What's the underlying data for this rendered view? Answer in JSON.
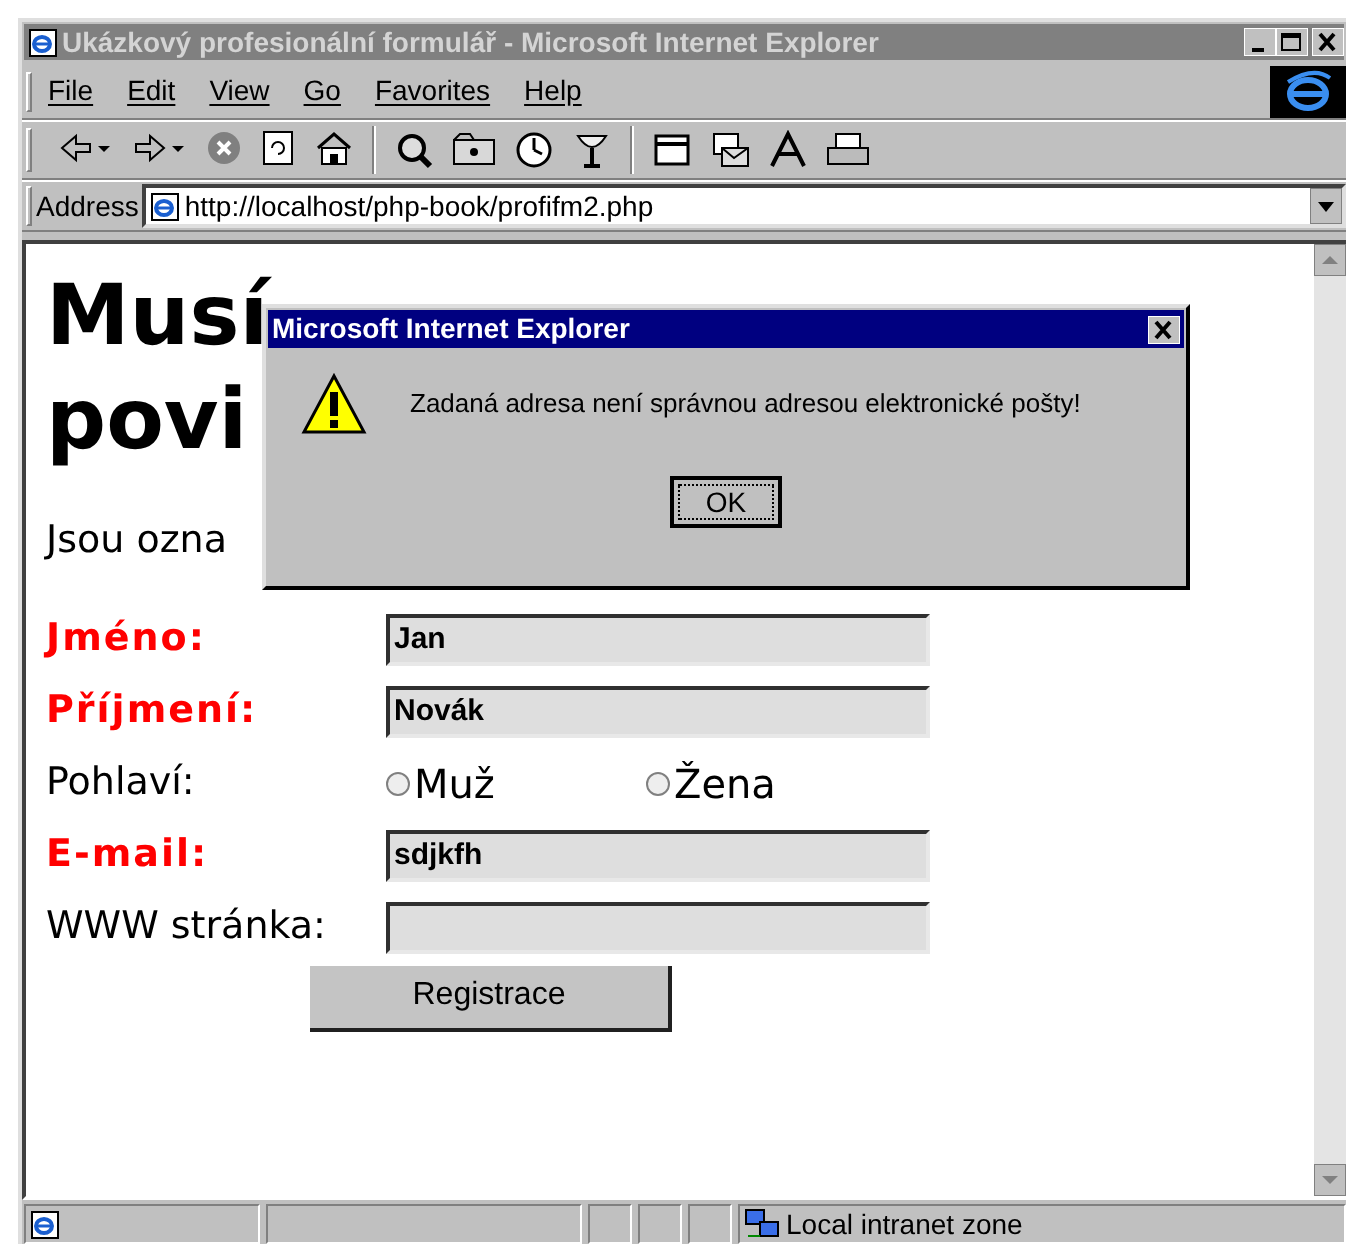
{
  "window": {
    "title": "Ukázkový profesionální formulář - Microsoft Internet Explorer"
  },
  "menu": [
    {
      "label": "File"
    },
    {
      "label": "Edit"
    },
    {
      "label": "View"
    },
    {
      "label": "Go"
    },
    {
      "label": "Favorites"
    },
    {
      "label": "Help"
    }
  ],
  "address_bar": {
    "label": "Address",
    "value": "http://localhost/php-book/profifm2.php"
  },
  "page": {
    "heading_lines": [
      "Musí",
      "povi"
    ],
    "note": "Jsou ozna",
    "fields": [
      {
        "kind": "text",
        "label": "Jméno:",
        "required": true,
        "value": "Jan"
      },
      {
        "kind": "text",
        "label": "Příjmení:",
        "required": true,
        "value": "Novák"
      },
      {
        "kind": "radio",
        "label": "Pohlaví:",
        "required": false,
        "options": [
          {
            "label": "Muž",
            "selected": false
          },
          {
            "label": "Žena",
            "selected": false
          }
        ]
      },
      {
        "kind": "text",
        "label": "E-mail:",
        "required": true,
        "value": "sdjkfh"
      },
      {
        "kind": "text",
        "label": "WWW stránka:",
        "required": false
      }
    ],
    "submit": "Registrace"
  },
  "dialog": {
    "title": "Microsoft Internet Explorer",
    "message": "Zadaná adresa není správnou adresou elektronické pošty!",
    "button": "OK"
  },
  "status_bar": {
    "zone": "Local intranet zone"
  }
}
